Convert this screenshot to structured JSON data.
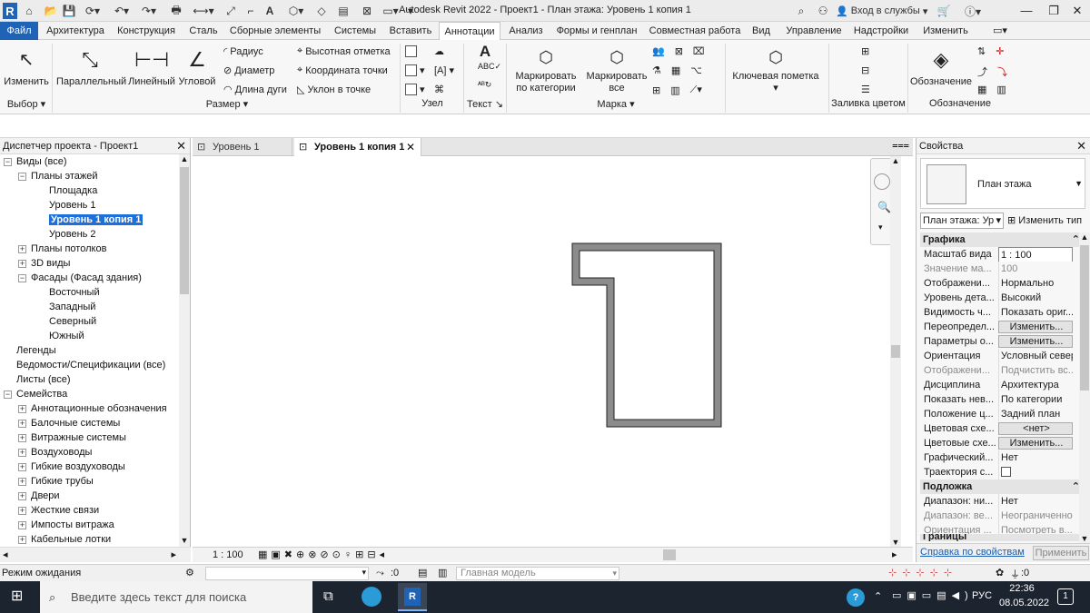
{
  "window": {
    "title": "Autodesk Revit 2022 - Проект1 - План этажа: Уровень 1 копия 1",
    "signin": "Вход в службы",
    "app_logo": "R"
  },
  "tabs": [
    "Файл",
    "Архитектура",
    "Конструкция",
    "Сталь",
    "Сборные элементы",
    "Системы",
    "Вставить",
    "Аннотации",
    "Анализ",
    "Формы и генплан",
    "Совместная работа",
    "Вид",
    "Управление",
    "Надстройки",
    "Изменить"
  ],
  "ribbon": {
    "select": {
      "modify": "Изменить",
      "panel": "Выбор"
    },
    "dimension": {
      "aligned": "Параллельный",
      "linear": "Линейный",
      "angular": "Угловой",
      "radius": "Радиус",
      "diameter": "Диаметр",
      "arc_length": "Длина дуги",
      "spot_elevation": "Высотная отметка",
      "spot_coordinate": "Координата точки",
      "spot_slope": "Уклон в точке",
      "panel": "Размер"
    },
    "detail": {
      "panel": "Узел"
    },
    "text": {
      "label": "A",
      "panel": "Текст"
    },
    "tag": {
      "by_category": "Маркировать по категории",
      "all": "Маркировать все",
      "panel": "Марка"
    },
    "keynote": {
      "label": "Ключевая пометка"
    },
    "color_fill": {
      "panel": "Заливка цветом"
    },
    "symbol": {
      "label": "Обозначение",
      "panel": "Обозначение"
    }
  },
  "browser": {
    "title": "Диспетчер проекта - Проект1",
    "items": [
      {
        "label": "Виды (все)",
        "level": 0,
        "expander": "−"
      },
      {
        "label": "Планы этажей",
        "level": 1,
        "expander": "−"
      },
      {
        "label": "Площадка",
        "level": 2
      },
      {
        "label": "Уровень 1",
        "level": 2
      },
      {
        "label": "Уровень 1 копия 1",
        "level": 2,
        "selected": true
      },
      {
        "label": "Уровень 2",
        "level": 2
      },
      {
        "label": "Планы потолков",
        "level": 1,
        "expander": "+"
      },
      {
        "label": "3D виды",
        "level": 1,
        "expander": "+"
      },
      {
        "label": "Фасады (Фасад здания)",
        "level": 1,
        "expander": "−"
      },
      {
        "label": "Восточный",
        "level": 2
      },
      {
        "label": "Западный",
        "level": 2
      },
      {
        "label": "Северный",
        "level": 2
      },
      {
        "label": "Южный",
        "level": 2
      },
      {
        "label": "Легенды",
        "level": 0
      },
      {
        "label": "Ведомости/Спецификации (все)",
        "level": 0
      },
      {
        "label": "Листы (все)",
        "level": 0
      },
      {
        "label": "Семейства",
        "level": 0,
        "expander": "−"
      },
      {
        "label": "Аннотационные обозначения",
        "level": 1,
        "expander": "+"
      },
      {
        "label": "Балочные системы",
        "level": 1,
        "expander": "+"
      },
      {
        "label": "Витражные системы",
        "level": 1,
        "expander": "+"
      },
      {
        "label": "Воздуховоды",
        "level": 1,
        "expander": "+"
      },
      {
        "label": "Гибкие воздуховоды",
        "level": 1,
        "expander": "+"
      },
      {
        "label": "Гибкие трубы",
        "level": 1,
        "expander": "+"
      },
      {
        "label": "Двери",
        "level": 1,
        "expander": "+"
      },
      {
        "label": "Жесткие связи",
        "level": 1,
        "expander": "+"
      },
      {
        "label": "Импосты витража",
        "level": 1,
        "expander": "+"
      },
      {
        "label": "Кабельные лотки",
        "level": 1,
        "expander": "+"
      }
    ]
  },
  "viewtabs": [
    {
      "label": "Уровень 1",
      "active": false
    },
    {
      "label": "Уровень 1 копия 1",
      "active": true
    }
  ],
  "view_status": {
    "scale": "1 : 100"
  },
  "properties": {
    "title": "Свойства",
    "type_name": "План этажа",
    "selector": "План этажа: Ур",
    "edit_type": "Изменить тип",
    "groups": {
      "graphics": "Графика",
      "underlay": "Подложка",
      "extents": "Границы"
    },
    "rows": [
      {
        "k": "Масштаб вида",
        "v": "1 : 100",
        "input": true
      },
      {
        "k": "Значение ма...",
        "v": "100",
        "gray": true
      },
      {
        "k": "Отображени...",
        "v": "Нормально"
      },
      {
        "k": "Уровень дета...",
        "v": "Высокий"
      },
      {
        "k": "Видимость ч...",
        "v": "Показать ориг..."
      },
      {
        "k": "Переопредел...",
        "v": "Изменить...",
        "button": true
      },
      {
        "k": "Параметры о...",
        "v": "Изменить...",
        "button": true
      },
      {
        "k": "Ориентация",
        "v": "Условный север"
      },
      {
        "k": "Отображени...",
        "v": "Подчистить вс...",
        "gray": true
      },
      {
        "k": "Дисциплина",
        "v": "Архитектура"
      },
      {
        "k": "Показать нев...",
        "v": "По категории"
      },
      {
        "k": "Положение ц...",
        "v": "Задний план"
      },
      {
        "k": "Цветовая схе...",
        "v": "<нет>",
        "button": true
      },
      {
        "k": "Цветовые схе...",
        "v": "Изменить...",
        "button": true
      },
      {
        "k": "Графический...",
        "v": "Нет"
      },
      {
        "k": "Траектория с...",
        "v": "",
        "checkbox": true
      }
    ],
    "underlay_rows": [
      {
        "k": "Диапазон: ни...",
        "v": "Нет"
      },
      {
        "k": "Диапазон: ве...",
        "v": "Неограниченно",
        "gray": true
      },
      {
        "k": "Ориентация ...",
        "v": "Посмотреть в...",
        "gray": true
      }
    ],
    "help_link": "Справка по свойствам",
    "apply": "Применить"
  },
  "statusbar": {
    "state": "Режим ожидания",
    "count": ":0",
    "model": "Главная модель",
    "filter": ":0"
  },
  "taskbar": {
    "search_placeholder": "Введите здесь текст для поиска",
    "lang": "РУС",
    "time": "22:36",
    "date": "08.05.2022",
    "notifications": "1"
  }
}
